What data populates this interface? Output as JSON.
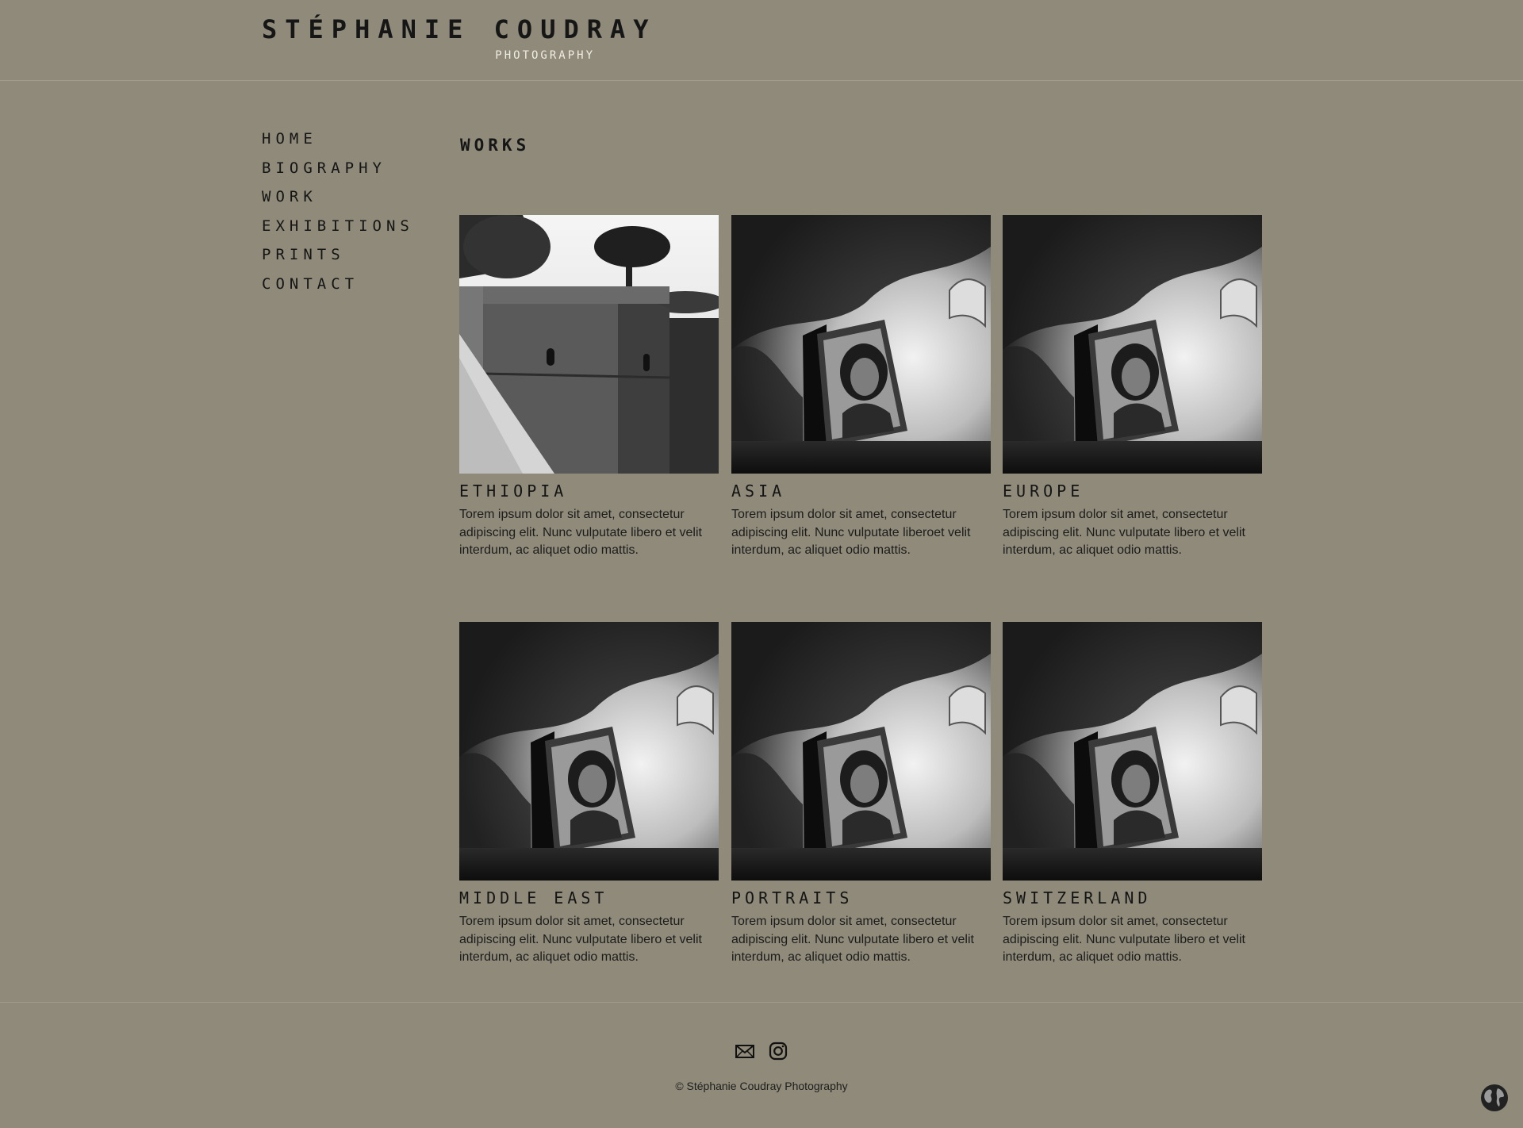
{
  "header": {
    "brand_name": "STÉPHANIE COUDRAY",
    "brand_sub": "PHOTOGRAPHY"
  },
  "nav": {
    "items": [
      {
        "label": "HOME"
      },
      {
        "label": "BIOGRAPHY"
      },
      {
        "label": "WORK"
      },
      {
        "label": "EXHIBITIONS"
      },
      {
        "label": "PRINTS"
      },
      {
        "label": "CONTACT"
      }
    ]
  },
  "main": {
    "title": "WORKS",
    "works": [
      {
        "title": "ETHIOPIA",
        "desc": "Torem ipsum dolor sit amet, consectetur adipiscing elit. Nunc vulputate libero et velit interdum, ac aliquet odio mattis.",
        "image": "rock-church-photo"
      },
      {
        "title": "ASIA",
        "desc": "Torem ipsum dolor sit amet, consectetur adipiscing elit. Nunc vulputate liberoet velit interdum, ac aliquet odio mattis.",
        "image": "icon-painting-photo"
      },
      {
        "title": "EUROPE",
        "desc": "Torem ipsum dolor sit amet, consectetur adipiscing elit. Nunc vulputate libero et velit interdum, ac aliquet odio mattis.",
        "image": "icon-painting-photo"
      },
      {
        "title": "MIDDLE EAST",
        "desc": "Torem ipsum dolor sit amet, consectetur adipiscing elit. Nunc vulputate libero et velit interdum, ac aliquet odio mattis.",
        "image": "icon-painting-photo"
      },
      {
        "title": "PORTRAITS",
        "desc": "Torem ipsum dolor sit amet, consectetur adipiscing elit. Nunc vulputate libero et velit interdum, ac aliquet odio mattis.",
        "image": "icon-painting-photo"
      },
      {
        "title": "SWITZERLAND",
        "desc": "Torem ipsum dolor sit amet, consectetur adipiscing elit. Nunc vulputate libero et velit interdum, ac aliquet odio mattis.",
        "image": "icon-painting-photo"
      }
    ]
  },
  "footer": {
    "icons": [
      "mail-icon",
      "instagram-icon"
    ],
    "copyright": "© Stéphanie Coudray Photography",
    "language_icon": "globe-icon"
  },
  "colors": {
    "background": "#8f8a79",
    "text": "#1a1a1a",
    "subtitle": "#f0ede4"
  }
}
